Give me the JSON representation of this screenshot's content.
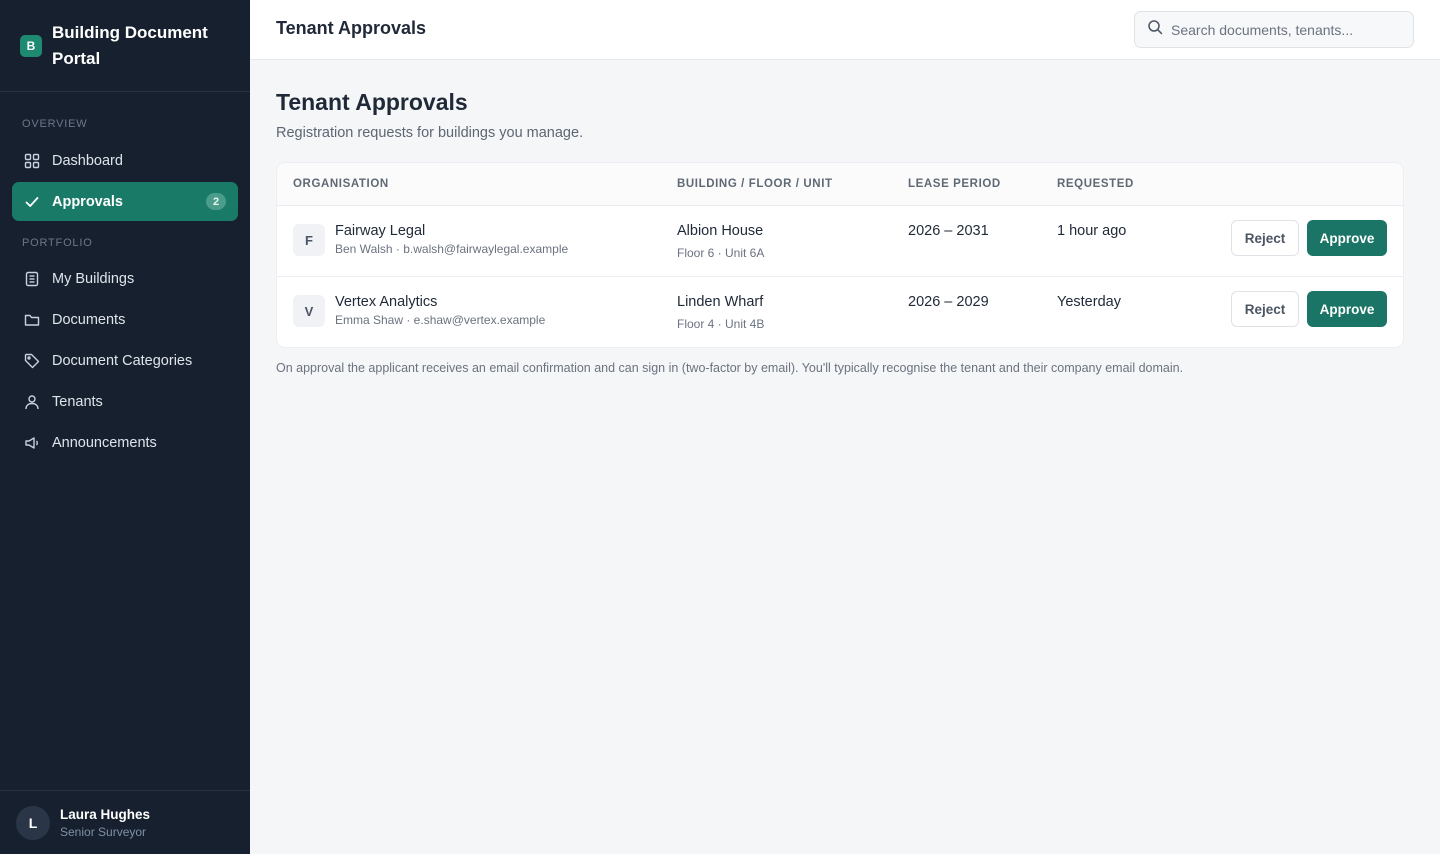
{
  "app": {
    "brand_initial": "B",
    "brand_name": "Building Document Portal"
  },
  "sidebar": {
    "section_overview": "OVERVIEW",
    "section_portfolio": "PORTFOLIO",
    "items": [
      {
        "label": "Dashboard",
        "icon": "grid-icon"
      },
      {
        "label": "Approvals",
        "icon": "check-icon",
        "badge": "2",
        "active": true
      },
      {
        "label": "My Buildings",
        "icon": "building-icon"
      },
      {
        "label": "Documents",
        "icon": "folder-icon"
      },
      {
        "label": "Document Categories",
        "icon": "tag-icon"
      },
      {
        "label": "Tenants",
        "icon": "user-icon"
      },
      {
        "label": "Announcements",
        "icon": "megaphone-icon"
      }
    ],
    "user": {
      "initial": "L",
      "name": "Laura Hughes",
      "role": "Senior Surveyor"
    }
  },
  "header": {
    "title": "Tenant Approvals",
    "search_placeholder": "Search documents, tenants..."
  },
  "main": {
    "title": "Tenant Approvals",
    "subtitle": "Registration requests for buildings you manage.",
    "columns": [
      "ORGANISATION",
      "BUILDING / FLOOR / UNIT",
      "LEASE PERIOD",
      "REQUESTED"
    ],
    "rows": [
      {
        "initial": "F",
        "org": "Fairway Legal",
        "contact": "Ben Walsh · b.walsh@fairwaylegal.example",
        "building": "Albion House",
        "unit": "Floor 6 · Unit 6A",
        "lease": "2026 – 2031",
        "requested": "1 hour ago",
        "reject_label": "Reject",
        "approve_label": "Approve"
      },
      {
        "initial": "V",
        "org": "Vertex Analytics",
        "contact": "Emma Shaw · e.shaw@vertex.example",
        "building": "Linden Wharf",
        "unit": "Floor 4 · Unit 4B",
        "lease": "2026 – 2029",
        "requested": "Yesterday",
        "reject_label": "Reject",
        "approve_label": "Approve"
      }
    ],
    "footnote": "On approval the applicant receives an email confirmation and can sign in (two-factor by email). You'll typically recognise the tenant and their company email domain."
  },
  "colors": {
    "sidebar_bg": "#16202f",
    "accent": "#1a7a68",
    "approve_button": "#1a7566"
  }
}
